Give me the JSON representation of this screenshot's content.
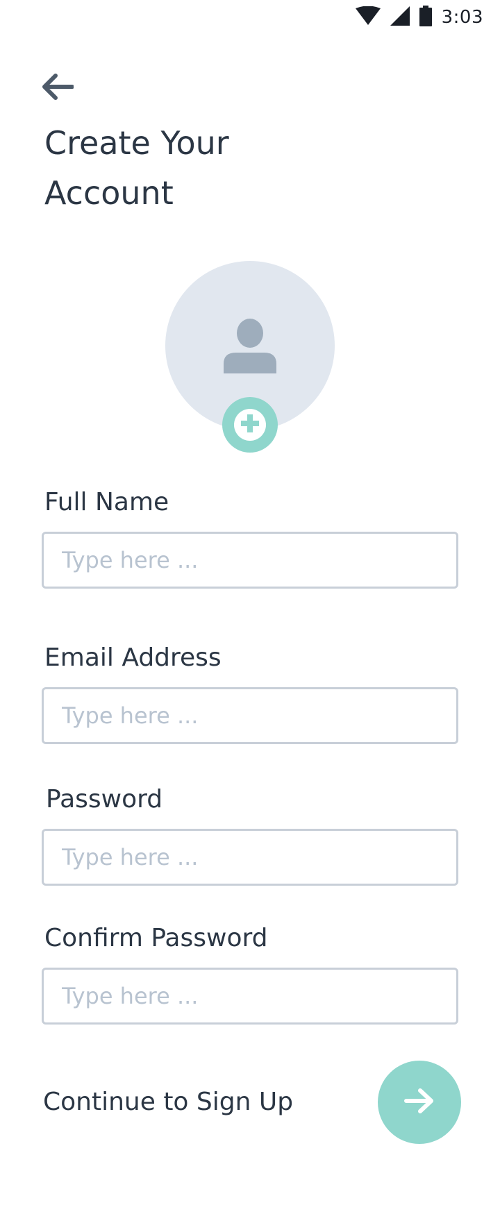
{
  "status_bar": {
    "time": "3:03",
    "icons": [
      "wifi-icon",
      "signal-icon",
      "battery-icon"
    ]
  },
  "header": {
    "back_icon": "arrow-left-icon",
    "title": "Create Your Account"
  },
  "avatar": {
    "icon": "person-icon",
    "add_icon": "plus-icon"
  },
  "form": {
    "full_name": {
      "label": "Full Name",
      "placeholder": "Type here ...",
      "value": ""
    },
    "email": {
      "label": "Email Address",
      "placeholder": "Type here ...",
      "value": ""
    },
    "password": {
      "label": "Password",
      "placeholder": "Type here ...",
      "value": ""
    },
    "confirm_password": {
      "label": "Confirm Password",
      "placeholder": "Type here ...",
      "value": ""
    }
  },
  "footer": {
    "continue_label": "Continue to Sign Up",
    "continue_icon": "arrow-right-icon"
  },
  "colors": {
    "accent": "#8fd6cc",
    "text": "#2b3644",
    "avatar_bg": "#e1e7ef",
    "avatar_icon": "#9eadbc",
    "input_border": "#c8cfd8",
    "placeholder": "#b8c3d0"
  }
}
